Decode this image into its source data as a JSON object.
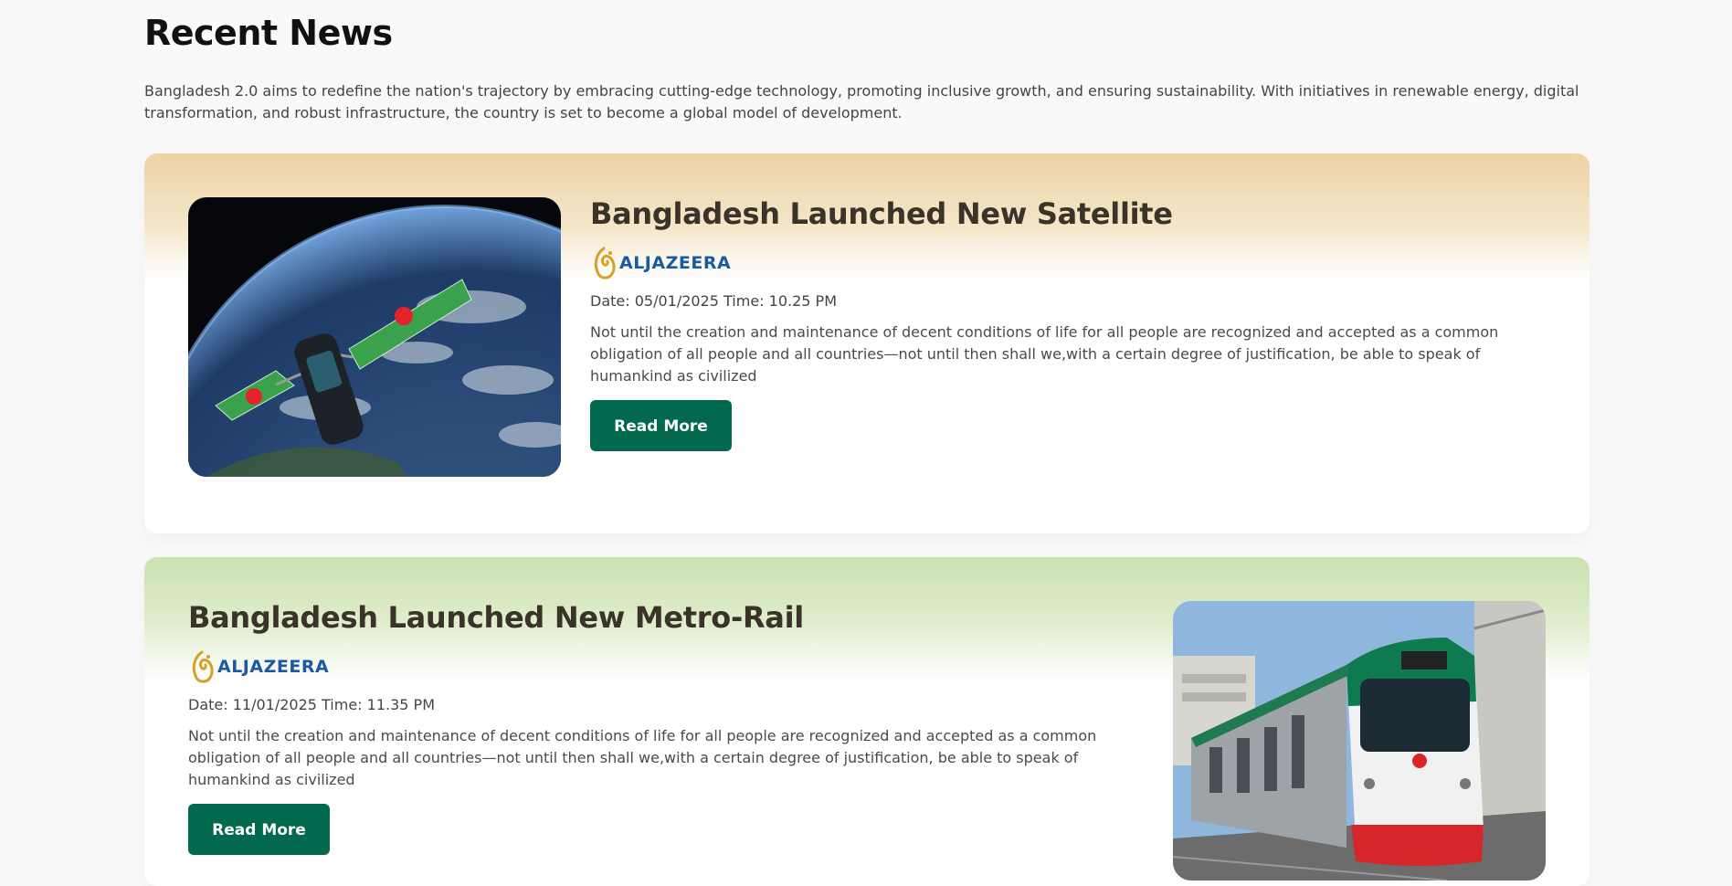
{
  "heading": "Recent News",
  "intro": "Bangladesh 2.0 aims to redefine the nation's trajectory by embracing cutting-edge technology, promoting inclusive growth, and ensuring sustainability. With initiatives in renewable energy, digital transformation, and robust infrastructure, the country is set to become a global model of development.",
  "articles": [
    {
      "title": "Bangladesh Launched New Satellite",
      "source": "ALJAZEERA",
      "meta": "Date: 05/01/2025 Time: 10.25 PM",
      "summary": "Not until the creation and maintenance of decent conditions of life for all people are recognized and accepted as a common obligation of all people and all countries—not until then shall we,with a certain degree of justification, be able to speak of humankind as civilized",
      "cta": "Read More",
      "bg_color": "#ecd3a5"
    },
    {
      "title": "Bangladesh Launched New Metro-Rail",
      "source": "ALJAZEERA",
      "meta": "Date: 11/01/2025 Time: 11.35 PM",
      "summary": "Not until the creation and maintenance of decent conditions of life for all people are recognized and accepted as a common obligation of all people and all countries—not until then shall we,with a certain degree of justification, be able to speak of humankind as civilized",
      "cta": "Read More",
      "bg_color": "#cbe1b0"
    }
  ],
  "colors": {
    "button": "#02694e",
    "source_text": "#1b5aa3",
    "logo_gold": "#d4a126"
  }
}
